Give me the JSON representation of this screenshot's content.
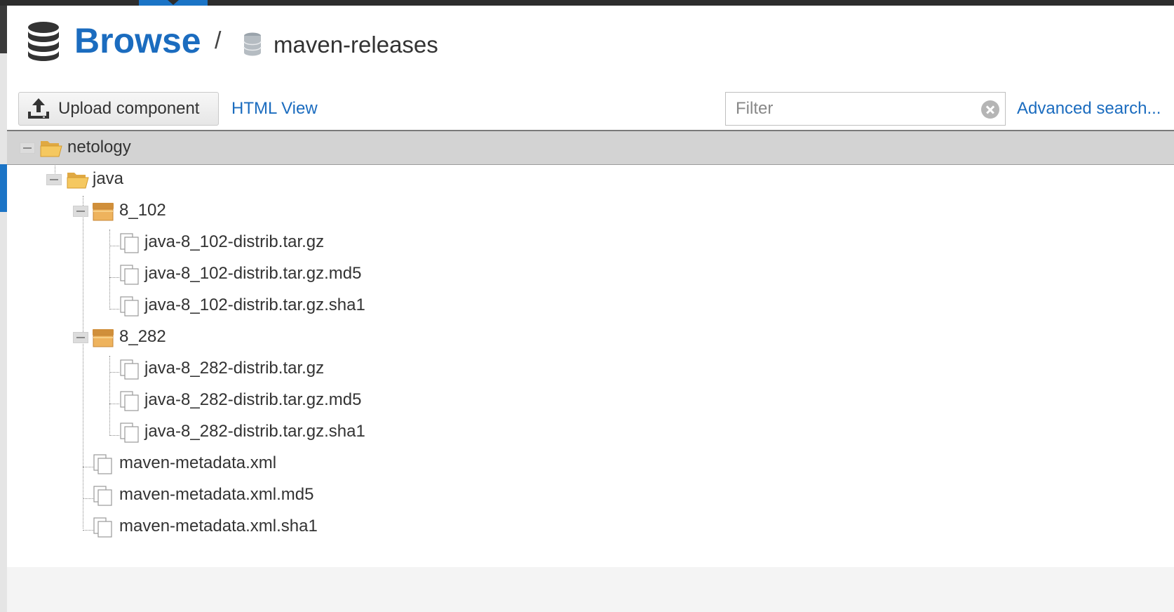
{
  "header": {
    "title": "Browse",
    "separator": "/",
    "repository": "maven-releases"
  },
  "toolbar": {
    "upload_label": "Upload component",
    "html_view_label": "HTML View",
    "filter_placeholder": "Filter",
    "advanced_search_label": "Advanced search..."
  },
  "tree": {
    "root": {
      "label": "netology",
      "icon": "folder-open-icon",
      "selected": true
    },
    "java": {
      "label": "java",
      "icon": "folder-open-icon"
    },
    "v1": {
      "label": "8_102",
      "icon": "component-box-icon",
      "files": [
        "java-8_102-distrib.tar.gz",
        "java-8_102-distrib.tar.gz.md5",
        "java-8_102-distrib.tar.gz.sha1"
      ]
    },
    "v2": {
      "label": "8_282",
      "icon": "component-box-icon",
      "files": [
        "java-8_282-distrib.tar.gz",
        "java-8_282-distrib.tar.gz.md5",
        "java-8_282-distrib.tar.gz.sha1"
      ]
    },
    "metadata": [
      "maven-metadata.xml",
      "maven-metadata.xml.md5",
      "maven-metadata.xml.sha1"
    ]
  },
  "colors": {
    "accent": "#1b6cbf",
    "selected_row": "#d3d3d3",
    "folder": "#f2c14e",
    "component": "#e0a552"
  }
}
